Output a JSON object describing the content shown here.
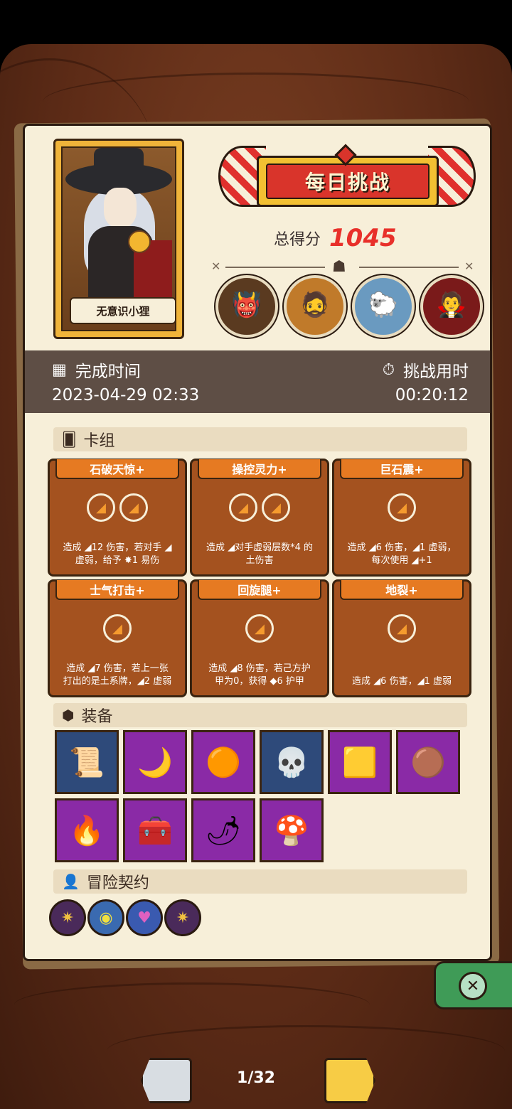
{
  "profile": {
    "name": "无意识小狸"
  },
  "challenge": {
    "title": "每日挑战",
    "score_label": "总得分",
    "score_value": "1045"
  },
  "opponents": [
    {
      "icon": "👹"
    },
    {
      "icon": "🧔"
    },
    {
      "icon": "🐑"
    },
    {
      "icon": "🧛"
    }
  ],
  "time": {
    "completed_label": "完成时间",
    "completed_value": "2023-04-29 02:33",
    "duration_label": "挑战用时",
    "duration_value": "00:20:12"
  },
  "deck": {
    "label": "卡组",
    "cards": [
      {
        "title": "石破天惊+",
        "icons": 2,
        "line1": "造成 ◢12 伤害，若对手 ◢",
        "line2": "虚弱，给予 ✸1 易伤"
      },
      {
        "title": "操控灵力+",
        "icons": 2,
        "line1": "造成 ◢对手虚弱层数*4 的",
        "line2": "土伤害"
      },
      {
        "title": "巨石震+",
        "icons": 1,
        "line1": "造成 ◢6 伤害，◢1 虚弱，",
        "line2": "每次使用 ◢+1"
      },
      {
        "title": "士气打击+",
        "icons": 1,
        "line1": "造成 ◢7 伤害，若上一张",
        "line2": "打出的是土系牌，◢2 虚弱"
      },
      {
        "title": "回旋腿+",
        "icons": 1,
        "line1": "造成 ◢8 伤害，若己方护",
        "line2": "甲为0，获得 ◆6 护甲"
      },
      {
        "title": "地裂+",
        "icons": 1,
        "line1": "造成 ◢6 伤害，◢1 虚弱",
        "line2": ""
      }
    ]
  },
  "equipment": {
    "label": "装备",
    "items": [
      {
        "name": "scroll",
        "icon": "📜",
        "color": "blue"
      },
      {
        "name": "moon-star",
        "icon": "🌙",
        "color": "purple"
      },
      {
        "name": "rock-orb",
        "icon": "🟠",
        "color": "purple"
      },
      {
        "name": "horned-skull",
        "icon": "💀",
        "color": "blue"
      },
      {
        "name": "gold-bars",
        "icon": "🟨",
        "color": "purple"
      },
      {
        "name": "leather-bracer",
        "icon": "🟤",
        "color": "purple"
      },
      {
        "name": "fire-gem",
        "icon": "🔥",
        "color": "purple"
      },
      {
        "name": "treasure-chest",
        "icon": "🧰",
        "color": "purple"
      },
      {
        "name": "red-pepper",
        "icon": "🌶",
        "color": "purple"
      },
      {
        "name": "spotted-mushroom",
        "icon": "🍄",
        "color": "purple"
      }
    ]
  },
  "contracts": {
    "label": "冒险契约",
    "items": [
      {
        "name": "spider-seal",
        "icon": "✷",
        "color": "#4a2a5a"
      },
      {
        "name": "eye-seal",
        "icon": "◉",
        "color": "#3a6ab0"
      },
      {
        "name": "heart-seal",
        "icon": "♥",
        "color": "#3a5ab0"
      },
      {
        "name": "spider-seal-2",
        "icon": "✷",
        "color": "#4a2a5a"
      }
    ]
  },
  "pagination": {
    "current": "1/32"
  }
}
